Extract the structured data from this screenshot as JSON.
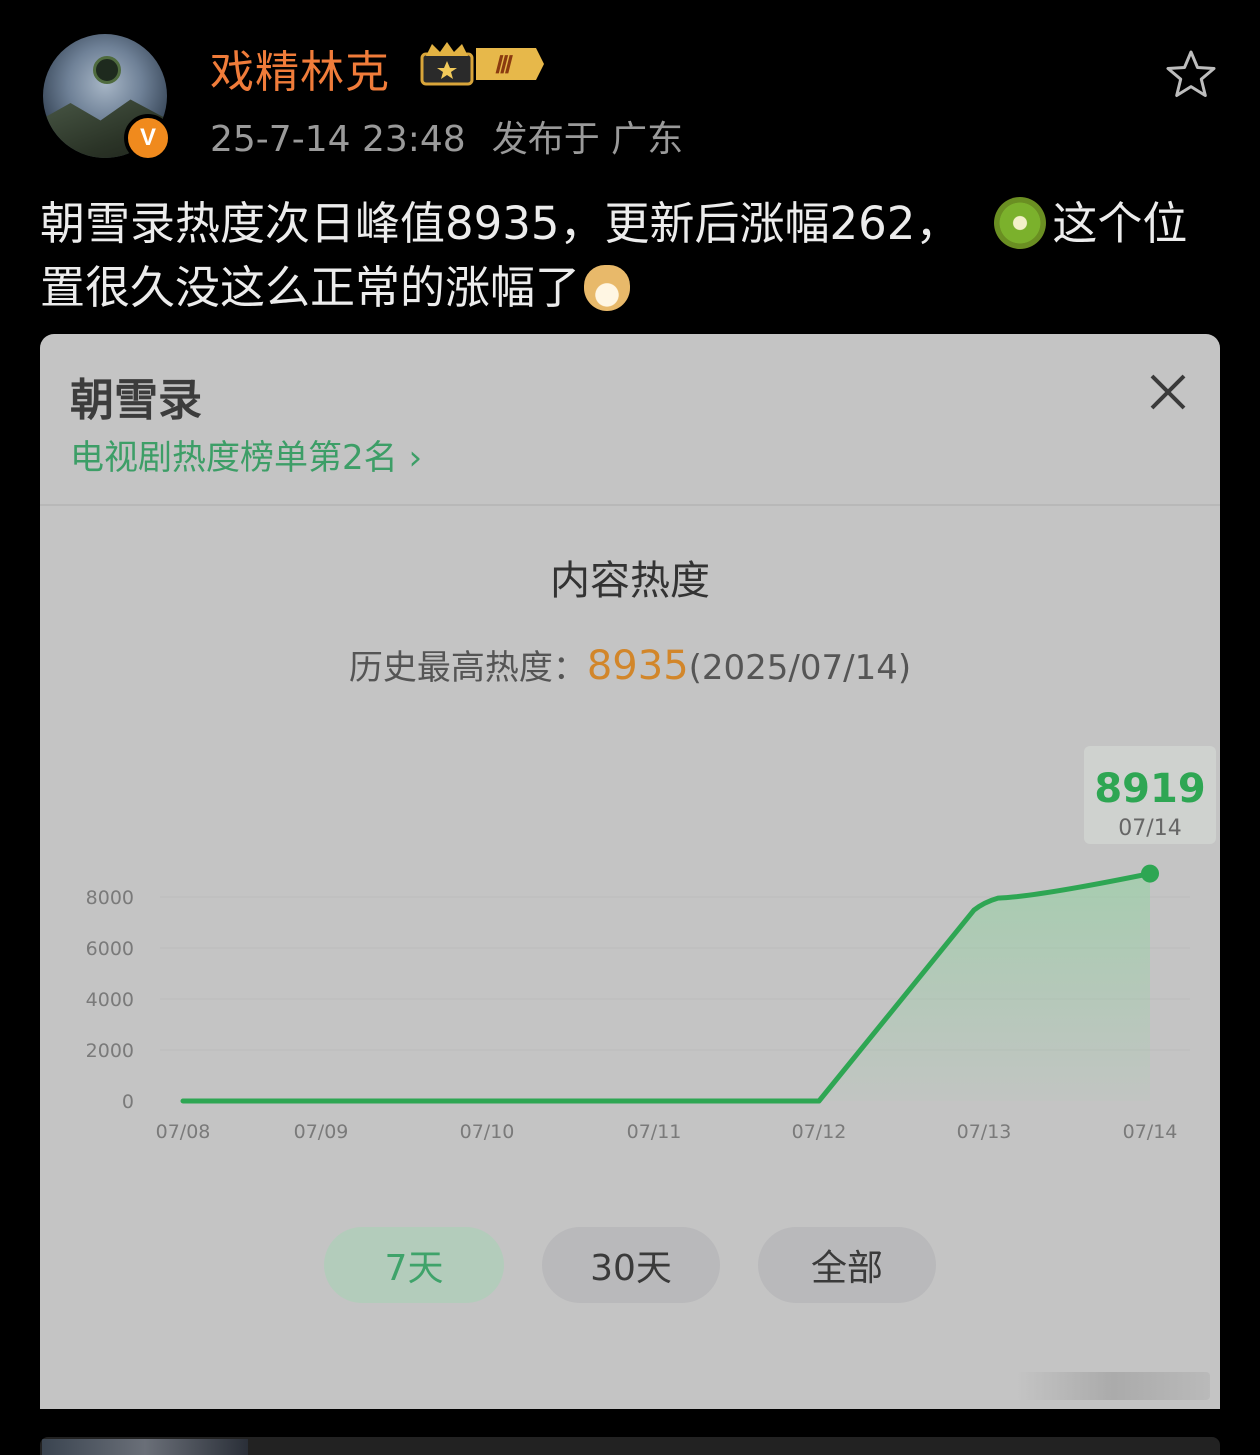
{
  "post": {
    "author": "戏精林克",
    "level_badge": "Ⅲ",
    "verified_mark": "V",
    "date": "25-7-14 23:48",
    "location": "发布于 广东",
    "text_part1": "朝雪录热度次日峰值8935，更新后涨幅262，",
    "text_part2": "这个位置很久没这么正常的涨幅了",
    "icons": [
      "favorite-star-icon",
      "kiwi-emoji",
      "doge-emoji"
    ]
  },
  "card": {
    "title": "朝雪录",
    "subtitle": "电视剧热度榜单第2名 ›",
    "section_title": "内容热度",
    "peak_label": "历史最高热度：",
    "peak_value": "8935",
    "peak_date": "(2025/07/14)",
    "tooltip_value": "8919",
    "tooltip_date": "07/14",
    "buttons": [
      "7天",
      "30天",
      "全部"
    ],
    "active_button": "7天",
    "accent_color": "#2ea653",
    "peak_color": "#d2862a"
  },
  "chart_data": {
    "type": "area",
    "x": [
      "07/08",
      "07/09",
      "07/10",
      "07/11",
      "07/12",
      "07/13",
      "07/14"
    ],
    "values": [
      0,
      0,
      0,
      0,
      0,
      7800,
      8919
    ],
    "y_ticks": [
      "0",
      "2000",
      "4000",
      "6000",
      "8000"
    ],
    "ylim": [
      0,
      10000
    ],
    "grid": true,
    "color": "#2ea653"
  }
}
